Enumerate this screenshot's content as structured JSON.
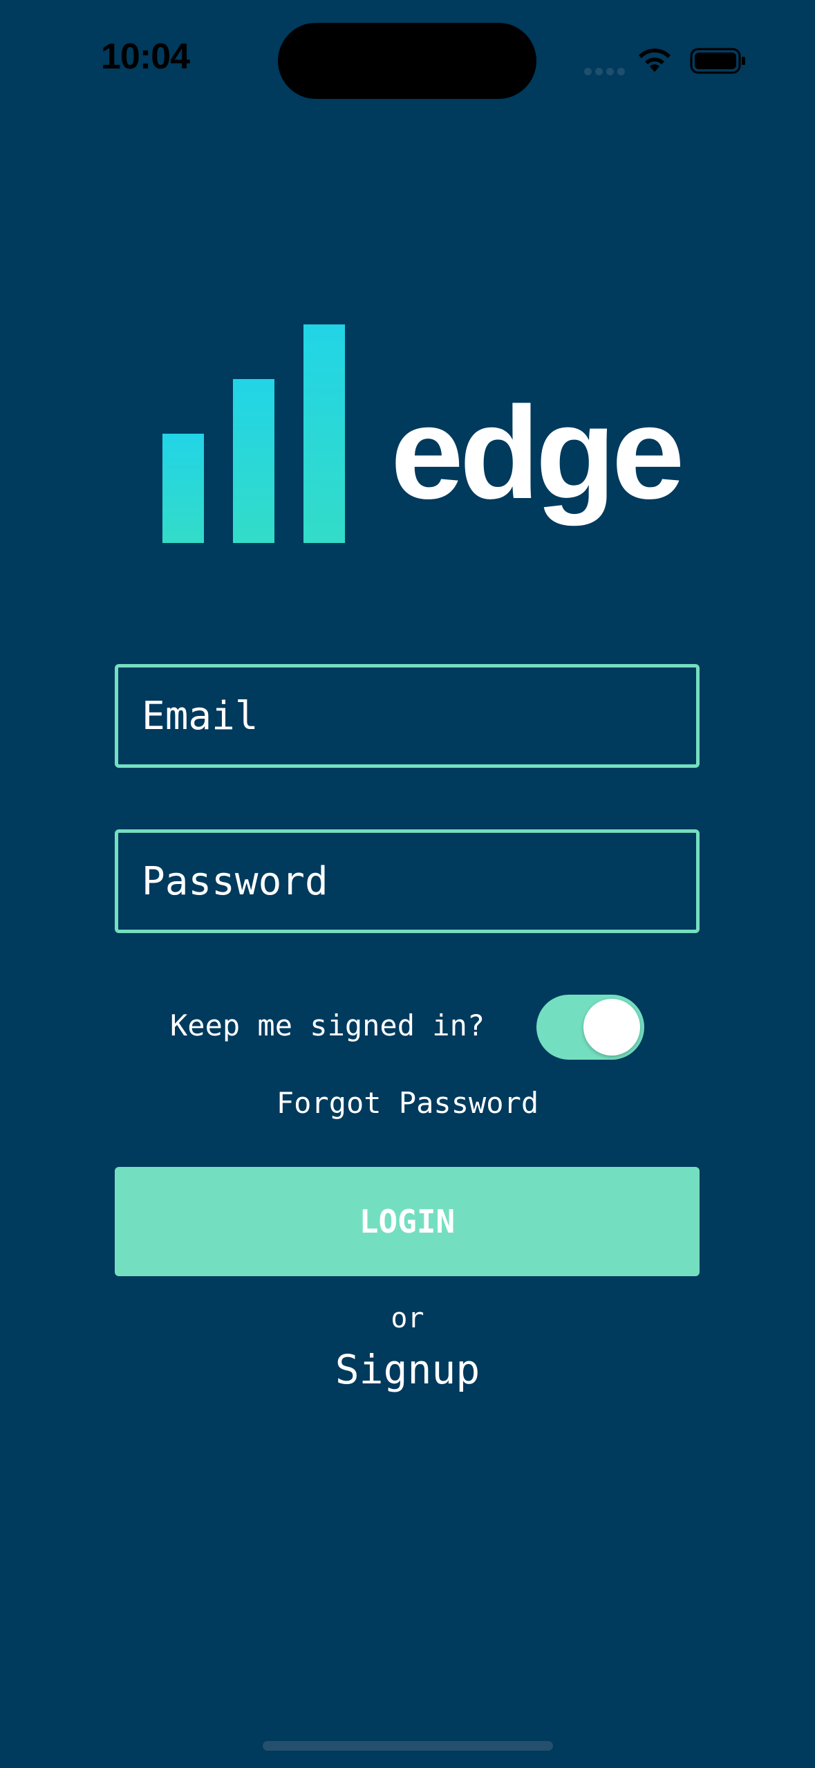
{
  "status_bar": {
    "time": "10:04",
    "icons": [
      "signal-dots-icon",
      "wifi-icon",
      "battery-icon"
    ]
  },
  "logo": {
    "wordmark": "edge",
    "icon": "bar-chart-logo-icon",
    "gradient_top": "#22d4e6",
    "gradient_bottom": "#33dcc8"
  },
  "form": {
    "email_placeholder": "Email",
    "email_value": "",
    "password_placeholder": "Password",
    "password_value": "",
    "keep_signed_in_label": "Keep me signed in?",
    "keep_signed_in_on": true,
    "forgot_password_label": "Forgot Password",
    "login_label": "LOGIN",
    "or_label": "or",
    "signup_label": "Signup"
  },
  "colors": {
    "background": "#003a5d",
    "accent": "#74dfc0",
    "text": "#ffffff"
  }
}
